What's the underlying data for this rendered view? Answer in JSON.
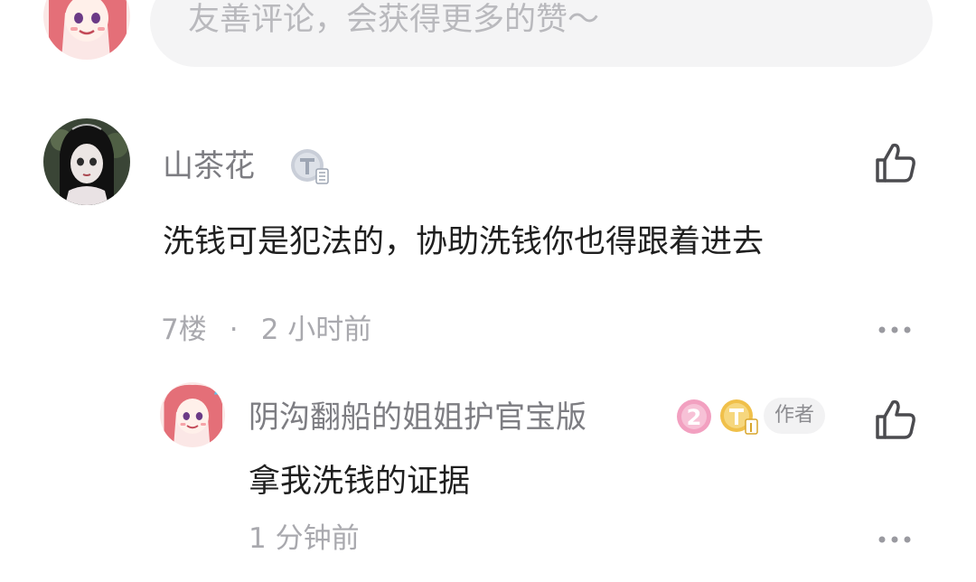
{
  "input": {
    "placeholder": "友善评论，会获得更多的赞～"
  },
  "comments": [
    {
      "username": "山茶花",
      "level_badge": "T3",
      "text": "洗钱可是犯法的，协助洗钱你也得跟着进去",
      "floor": "7楼",
      "separator": "·",
      "time": "2 小时前",
      "replies": [
        {
          "username": "阴沟翻船的姐姐护官宝版",
          "rank_badge": "2",
          "level_badge": "T1",
          "author_label": "作者",
          "text": "拿我洗钱的证据",
          "time": "1 分钟前"
        }
      ]
    }
  ],
  "icons": {
    "like": "thumbs-up-icon",
    "more": "more-dots-icon"
  },
  "colors": {
    "meta_gray": "#a9a9ae",
    "name_gray": "#7d7d82",
    "rank_badge_pink": "#f2a0c0",
    "level_badge_gold": "#f0c04a",
    "level_badge_silver": "#c9ced8"
  }
}
